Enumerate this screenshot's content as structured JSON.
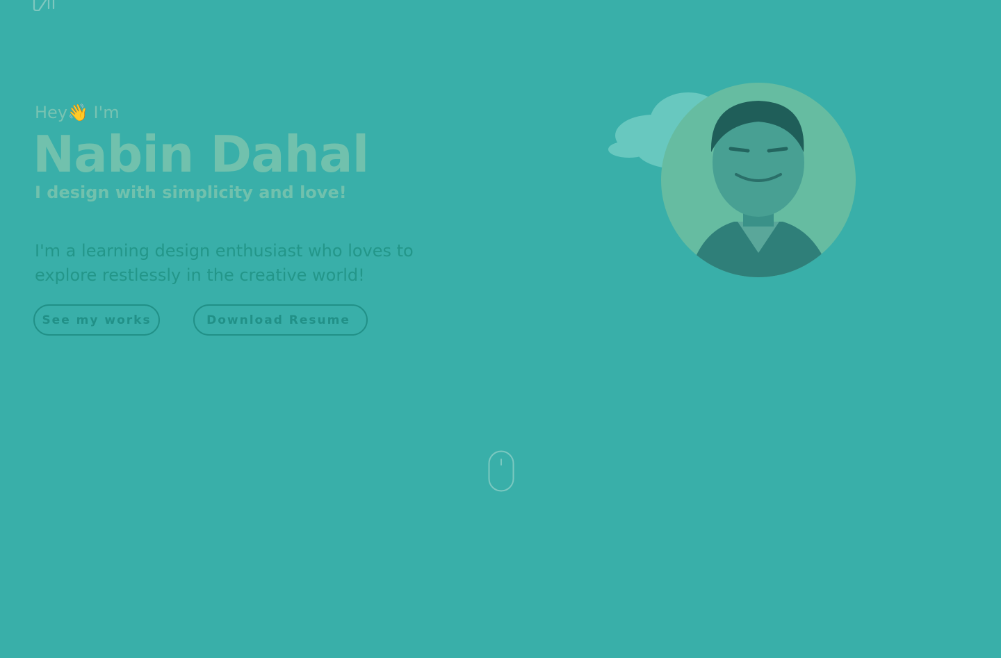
{
  "hero": {
    "greeting": "Hey👋 I'm",
    "name": "Nabin Dahal",
    "tagline": "I design with simplicity and love!",
    "about": "I'm a learning design enthusiast who loves to explore restlessly in the creative world!",
    "see_works_label": "See my works",
    "resume_label": "Download Resume"
  },
  "icons": {
    "logo": "logo-icon",
    "resume": "arrow-down-icon",
    "scroll": "mouse-scroll-icon"
  },
  "colors": {
    "background": "#39afa9",
    "accent": "#71c1ad",
    "text_dark": "#239689",
    "avatar_bg": "#66bca1"
  }
}
